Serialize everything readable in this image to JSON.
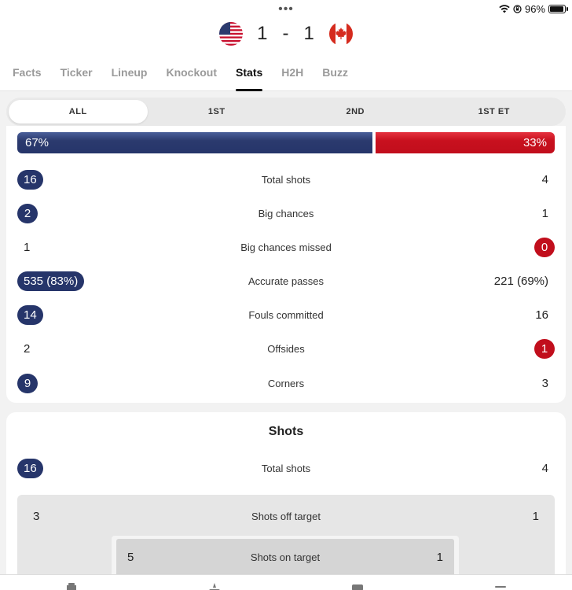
{
  "status": {
    "battery": "96%"
  },
  "match": {
    "home_score": "1",
    "separator": "-",
    "away_score": "1"
  },
  "tabs": [
    {
      "label": "Facts"
    },
    {
      "label": "Ticker"
    },
    {
      "label": "Lineup"
    },
    {
      "label": "Knockout"
    },
    {
      "label": "Stats",
      "active": true
    },
    {
      "label": "H2H"
    },
    {
      "label": "Buzz"
    }
  ],
  "periods": [
    {
      "label": "ALL",
      "active": true
    },
    {
      "label": "1ST"
    },
    {
      "label": "2ND"
    },
    {
      "label": "1ST ET"
    }
  ],
  "possession": {
    "home": "67%",
    "away": "33%",
    "home_value": 67
  },
  "overview": [
    {
      "label": "Total shots",
      "home": "16",
      "away": "4",
      "highlight": "home"
    },
    {
      "label": "Big chances",
      "home": "2",
      "away": "1",
      "highlight": "home"
    },
    {
      "label": "Big chances missed",
      "home": "1",
      "away": "0",
      "highlight": "away"
    },
    {
      "label": "Accurate passes",
      "home": "535 (83%)",
      "away": "221 (69%)",
      "highlight": "home"
    },
    {
      "label": "Fouls committed",
      "home": "14",
      "away": "16",
      "highlight": "home"
    },
    {
      "label": "Offsides",
      "home": "2",
      "away": "1",
      "highlight": "away"
    },
    {
      "label": "Corners",
      "home": "9",
      "away": "3",
      "highlight": "home"
    }
  ],
  "shots": {
    "title": "Shots",
    "total": {
      "label": "Total shots",
      "home": "16",
      "away": "4"
    },
    "off_target": {
      "label": "Shots off target",
      "home": "3",
      "away": "1"
    },
    "on_target": {
      "label": "Shots on target",
      "home": "5",
      "away": "1"
    }
  },
  "colors": {
    "home": "#26356a",
    "away": "#c10e1c"
  }
}
